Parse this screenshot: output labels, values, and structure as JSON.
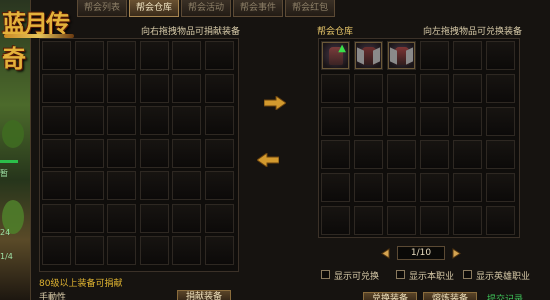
{
  "logo": {
    "text": "蓝月传奇"
  },
  "tabs": [
    {
      "label": "帮会列表",
      "active": false
    },
    {
      "label": "帮会仓库",
      "active": true
    },
    {
      "label": "帮会活动",
      "active": false
    },
    {
      "label": "帮会事件",
      "active": false
    },
    {
      "label": "帮会红包",
      "active": false
    }
  ],
  "left_panel": {
    "header": "向右拖拽物品可捐献装备"
  },
  "right_panel": {
    "title": "帮会仓库",
    "header": "向左拖拽物品可兑换装备",
    "items": [
      {
        "slot": 0,
        "name": "armor-with-upgrade",
        "upgrade": "▲",
        "colors": [
          "#7a3c3c",
          "#3b2424"
        ]
      },
      {
        "slot": 1,
        "name": "armor-winged",
        "colors": [
          "#6c2f2f",
          "#2f1d1d"
        ]
      },
      {
        "slot": 2,
        "name": "armor-winged-2",
        "colors": [
          "#7e3535",
          "#301e1e"
        ]
      }
    ]
  },
  "pager": {
    "text": "1/10"
  },
  "checkboxes": [
    {
      "label": "显示可兑换",
      "checked": false
    },
    {
      "label": "显示本职业",
      "checked": false
    },
    {
      "label": "显示英雄职业",
      "checked": false
    }
  ],
  "bottom": {
    "note": "80级以上装备可捐献",
    "left_line2": "手動性",
    "btn1": "捐献装备",
    "btn2": "兑换装备",
    "btn3": "熔炼装备",
    "green_text": "提交记录"
  },
  "scenery_texts": [
    "暂",
    "24",
    "1/4"
  ],
  "colors": {
    "accent": "#e9c86b",
    "panel": "#161310",
    "cell_border": "#2e2822"
  }
}
